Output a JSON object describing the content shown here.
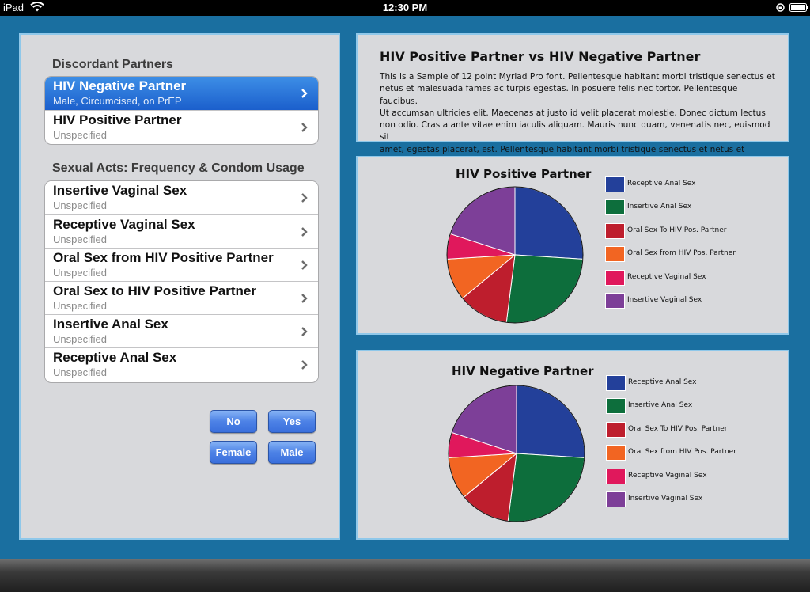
{
  "status_bar": {
    "device": "iPad",
    "time": "12:30 PM"
  },
  "left": {
    "discordant_header": "Discordant Partners",
    "partners": [
      {
        "title": "HIV Negative Partner",
        "subtitle": "Male, Circumcised, on PrEP",
        "selected": true
      },
      {
        "title": "HIV Positive Partner",
        "subtitle": "Unspecified",
        "selected": false
      }
    ],
    "acts_header": "Sexual Acts: Frequency & Condom Usage",
    "acts": [
      {
        "title": "Insertive Vaginal Sex",
        "subtitle": "Unspecified"
      },
      {
        "title": "Receptive Vaginal Sex",
        "subtitle": "Unspecified"
      },
      {
        "title": "Oral Sex from HIV Positive Partner",
        "subtitle": "Unspecified"
      },
      {
        "title": "Oral Sex to HIV Positive Partner",
        "subtitle": "Unspecified"
      },
      {
        "title": "Insertive Anal Sex",
        "subtitle": "Unspecified"
      },
      {
        "title": "Receptive Anal Sex",
        "subtitle": "Unspecified"
      }
    ],
    "buttons": {
      "no": "No",
      "yes": "Yes",
      "female": "Female",
      "male": "Male"
    }
  },
  "description": {
    "title": "HIV Positive Partner vs HIV Negative Partner",
    "lines": [
      "This is a Sample of 12 point Myriad Pro font. Pellentesque habitant morbi tristique senectus et",
      "netus et malesuada fames ac turpis egestas. In posuere felis nec tortor. Pellentesque faucibus.",
      "Ut accumsan ultricies elit. Maecenas at justo id velit placerat molestie. Donec dictum lectus",
      "non odio. Cras a ante vitae enim iaculis aliquam. Mauris nunc quam, venenatis nec, euismod sit",
      "amet, egestas placerat, est. Pellentesque habitant morbi tristique senectus et netus et malesua-"
    ]
  },
  "colors": {
    "receptive_anal": "#23409a",
    "insertive_anal": "#0d6e3c",
    "oral_to": "#be1e2d",
    "oral_from": "#f26522",
    "receptive_vaginal": "#e0185c",
    "insertive_vaginal": "#7d3f98"
  },
  "chart_data": [
    {
      "type": "pie",
      "title": "HIV Positive Partner",
      "categories": [
        "Receptive Anal Sex",
        "Insertive Anal Sex",
        "Oral Sex To HIV Pos. Partner",
        "Oral Sex from HIV Pos. Partner",
        "Receptive Vaginal Sex",
        "Insertive Vaginal Sex"
      ],
      "values": [
        26,
        26,
        12,
        10,
        6,
        20
      ],
      "colors": [
        "#23409a",
        "#0d6e3c",
        "#be1e2d",
        "#f26522",
        "#e0185c",
        "#7d3f98"
      ],
      "legend": "right"
    },
    {
      "type": "pie",
      "title": "HIV Negative Partner",
      "categories": [
        "Receptive Anal Sex",
        "Insertive Anal Sex",
        "Oral Sex To HIV Pos. Partner",
        "Oral Sex from HIV Pos. Partner",
        "Receptive Vaginal Sex",
        "Insertive Vaginal Sex"
      ],
      "values": [
        26,
        26,
        12,
        10,
        6,
        20
      ],
      "colors": [
        "#23409a",
        "#0d6e3c",
        "#be1e2d",
        "#f26522",
        "#e0185c",
        "#7d3f98"
      ],
      "legend": "right"
    }
  ]
}
